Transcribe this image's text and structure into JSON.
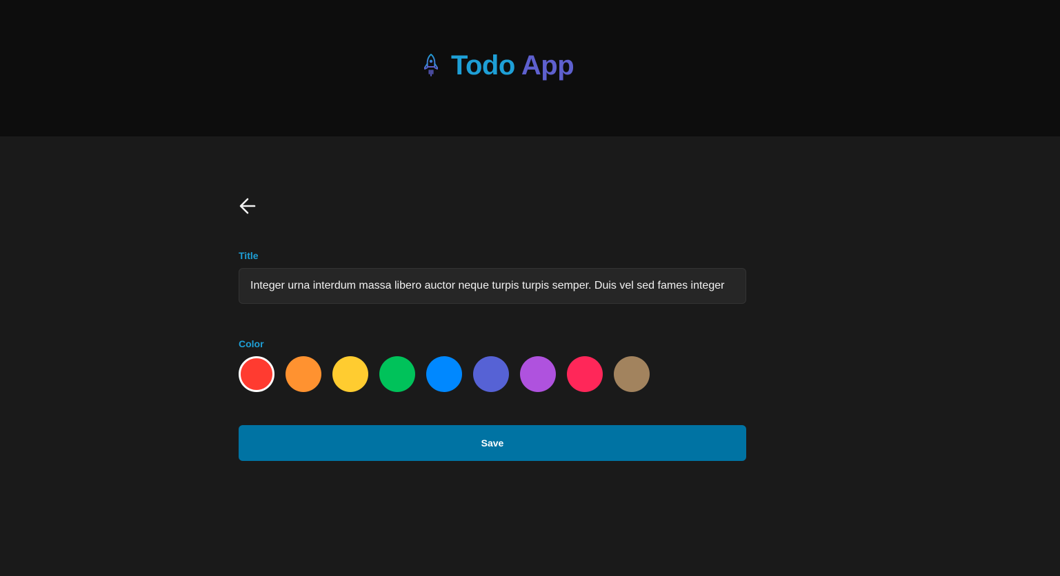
{
  "app": {
    "title_word1": "Todo",
    "title_word2": "App",
    "logo_icon": "rocket-icon",
    "brand_colors": {
      "primary": "#1e9fd6",
      "secondary": "#5e60ce"
    }
  },
  "form": {
    "back_icon": "arrow-left-icon",
    "title_label": "Title",
    "title_value": "Integer urna interdum massa libero auctor neque turpis turpis semper. Duis vel sed fames integer",
    "color_label": "Color",
    "colors": [
      {
        "hex": "#ff3b30",
        "selected": true
      },
      {
        "hex": "#ff9230"
      },
      {
        "hex": "#ffcc30"
      },
      {
        "hex": "#00c25a"
      },
      {
        "hex": "#0088ff"
      },
      {
        "hex": "#5662d5"
      },
      {
        "hex": "#af52de"
      },
      {
        "hex": "#ff2759"
      },
      {
        "hex": "#a2835e"
      }
    ],
    "save_label": "Save",
    "save_color": "#0073a3"
  }
}
